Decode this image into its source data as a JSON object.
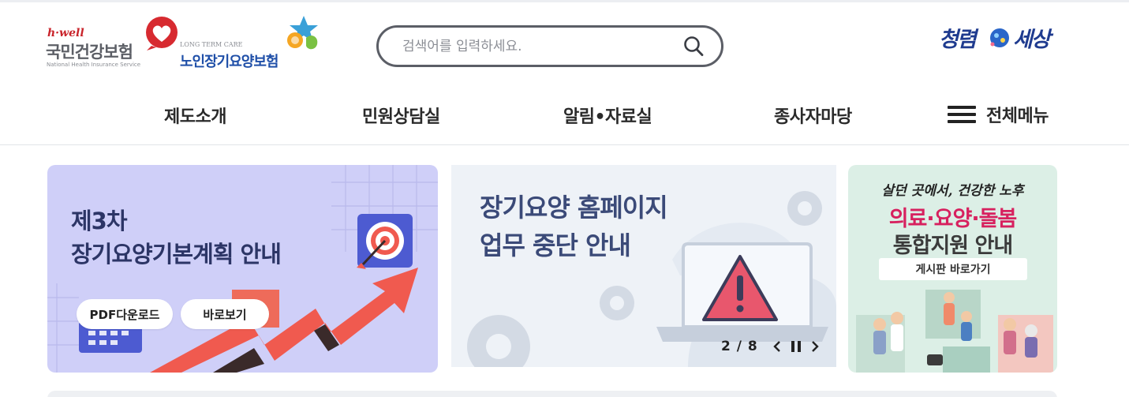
{
  "header": {
    "nhis_logo": {
      "tagline": "h·well",
      "name": "국민건강보험",
      "name_en": "National Health Insurance Service"
    },
    "ltc_logo": {
      "name_en": "LONG TERM CARE",
      "name": "노인장기요양보험"
    },
    "search": {
      "placeholder": "검색어를 입력하세요.",
      "value": ""
    },
    "campaign_logo": {
      "left": "청렴",
      "right": "세상"
    }
  },
  "nav": {
    "items": [
      "제도소개",
      "민원상담실",
      "알림•자료실",
      "종사자마당"
    ],
    "all_menu_label": "전체메뉴"
  },
  "banners": {
    "plan": {
      "title_line1": "제3차",
      "title_line2": "장기요양기본계획 안내",
      "pdf_label": "PDF다운로드",
      "view_label": "바로보기"
    },
    "outage": {
      "title_line1": "장기요양 홈페이지",
      "title_line2": "업무 중단 안내",
      "pager_current": "2",
      "pager_total": "8"
    },
    "care": {
      "head": "살던 곳에서, 건강한 노후",
      "line1": "의료·요양·돌봄",
      "line2": "통합지원 안내",
      "button_label": "게시판 바로가기"
    }
  },
  "colors": {
    "nhis_red": "#c9242b",
    "ltc_blue": "#1f4fa8",
    "campaign_navy": "#1f3b8f",
    "banner1_bg": "#cfcff8",
    "banner2_bg": "#eef2f7",
    "banner3_bg": "#dcefe6",
    "accent_pink": "#d7215f"
  }
}
